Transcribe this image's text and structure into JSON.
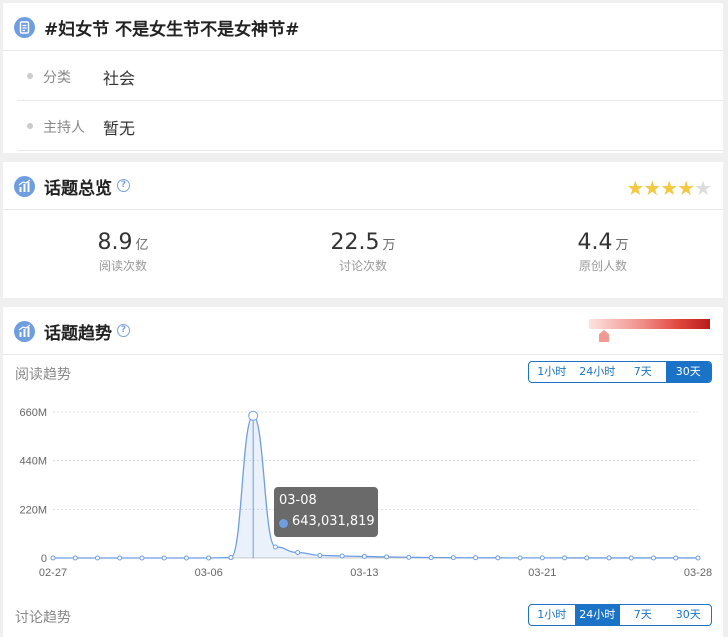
{
  "topic": {
    "title": "#妇女节 不是女生节不是女神节#",
    "category_label": "分类",
    "category_value": "社会",
    "host_label": "主持人",
    "host_value": "暂无"
  },
  "overview": {
    "title": "话题总览",
    "help": "?",
    "stars": "★★★★",
    "half_star": "★",
    "rating": 4.5,
    "stats": [
      {
        "value": "8.9",
        "unit": "亿",
        "label": "阅读次数"
      },
      {
        "value": "22.5",
        "unit": "万",
        "label": "讨论次数"
      },
      {
        "value": "4.4",
        "unit": "万",
        "label": "原创人数"
      }
    ]
  },
  "trend": {
    "title": "话题趋势",
    "help": "?",
    "read_label": "阅读趋势",
    "discuss_label": "讨论趋势",
    "ranges": [
      "1小时",
      "24小时",
      "7天",
      "30天"
    ],
    "read_active": "30天",
    "discuss_active": "24小时",
    "tooltip_date": "03-08",
    "tooltip_value": "643,031,819"
  },
  "colors": {
    "accent": "#1a73c6",
    "line": "#6f9ee0",
    "star": "#f5c842"
  },
  "chart_data": {
    "type": "area",
    "title": "",
    "xlabel": "",
    "ylabel": "",
    "ylim": [
      0,
      660000000
    ],
    "yticks": [
      "0",
      "220M",
      "440M",
      "660M"
    ],
    "ytick_values": [
      0,
      220000000,
      440000000,
      660000000
    ],
    "xtick_labels": [
      "02-27",
      "03-06",
      "03-13",
      "03-21",
      "03-28"
    ],
    "x": [
      "02-27",
      "02-28",
      "03-01",
      "03-02",
      "03-03",
      "03-04",
      "03-05",
      "03-06",
      "03-07",
      "03-08",
      "03-09",
      "03-10",
      "03-11",
      "03-12",
      "03-13",
      "03-14",
      "03-15",
      "03-16",
      "03-17",
      "03-18",
      "03-19",
      "03-20",
      "03-21",
      "03-22",
      "03-23",
      "03-24",
      "03-25",
      "03-26",
      "03-27",
      "03-28"
    ],
    "series": [
      {
        "values": [
          0,
          0,
          0,
          0,
          0,
          0,
          0,
          0,
          2000000,
          643031819,
          50000000,
          25000000,
          12000000,
          9000000,
          7000000,
          5000000,
          3000000,
          2000000,
          1500000,
          1000000,
          800000,
          600000,
          500000,
          400000,
          300000,
          300000,
          200000,
          200000,
          200000,
          200000
        ]
      }
    ],
    "grid": true
  }
}
